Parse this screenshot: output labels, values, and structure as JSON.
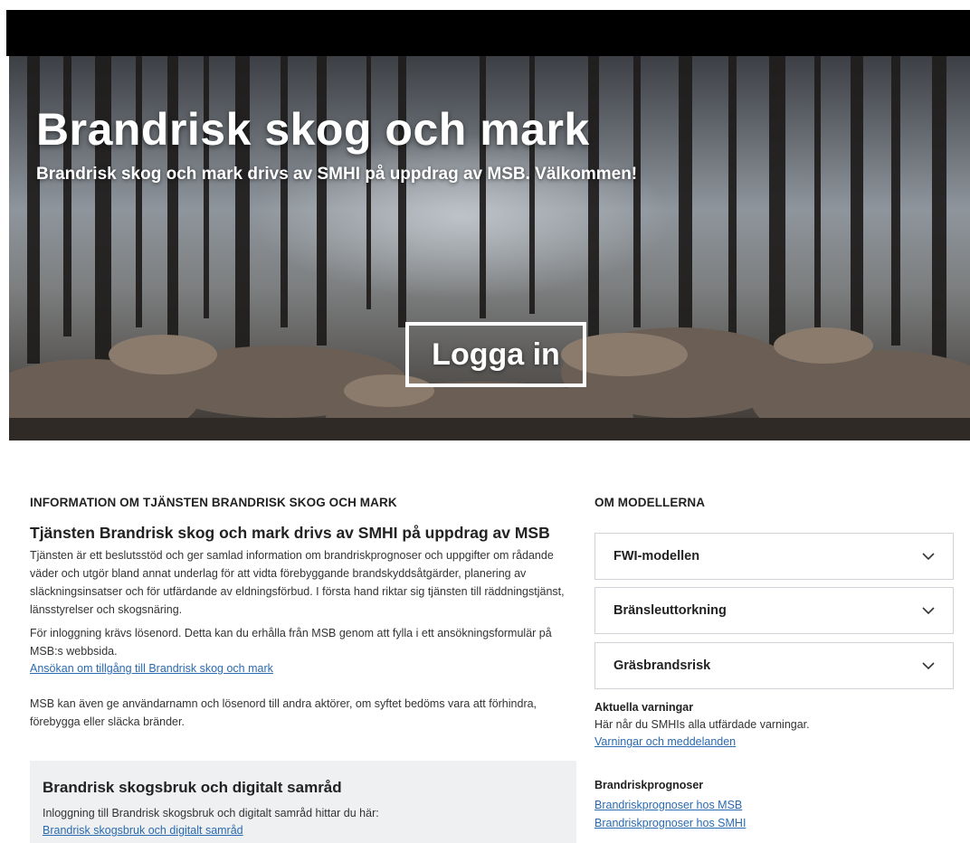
{
  "hero": {
    "title": "Brandrisk skog och mark",
    "subtitle": "Brandrisk skog och mark drivs av SMHI på uppdrag av MSB. Välkommen!",
    "login_label": "Logga in"
  },
  "info": {
    "heading": "INFORMATION OM TJÄNSTEN BRANDRISK SKOG OCH MARK",
    "lead": "Tjänsten Brandrisk skog och mark drivs av SMHI på uppdrag av MSB",
    "para1": "Tjänsten är ett beslutsstöd och ger samlad information om brandriskprognoser och uppgifter om rådande väder och utgör bland annat underlag för att vidta förebyggande brandskyddsåtgärder, planering av släckningsinsatser och för utfärdande av eldningsförbud. I första hand riktar sig tjänsten till räddningstjänst, länsstyrelser och skogsnäring.",
    "para2": "För inloggning krävs lösenord. Detta kan du erhålla från MSB genom att fylla i ett ansökningsformulär på MSB:s webbsida.",
    "apply_link": "Ansökan om tillgång till Brandrisk skog och mark",
    "para3": "MSB kan även ge användarnamn och lösenord till andra aktörer, om syftet bedöms vara att förhindra, förebygga eller släcka bränder."
  },
  "box": {
    "title": "Brandrisk skogsbruk och digitalt samråd",
    "text": "Inloggning till Brandrisk skogsbruk och digitalt samråd hittar du här:",
    "link": "Brandrisk skogsbruk och digitalt samråd"
  },
  "models": {
    "heading": "OM MODELLERNA",
    "items": [
      {
        "label": "FWI-modellen",
        "icon": "chevron-down-icon"
      },
      {
        "label": "Bränsleuttorkning",
        "icon": "chevron-down-icon"
      },
      {
        "label": "Gräsbrandsrisk",
        "icon": "chevron-down-icon"
      }
    ]
  },
  "warnings": {
    "heading": "Aktuella varningar",
    "text": "Här når du SMHIs alla utfärdade varningar.",
    "link": "Varningar och meddelanden"
  },
  "forecasts": {
    "heading": "Brandriskprognoser",
    "link_msb": "Brandriskprognoser hos MSB",
    "link_smhi": "Brandriskprognoser hos SMHI"
  },
  "colors": {
    "link": "#2a6ab0",
    "box_bg": "#eef0f2",
    "topbar": "#000000"
  }
}
